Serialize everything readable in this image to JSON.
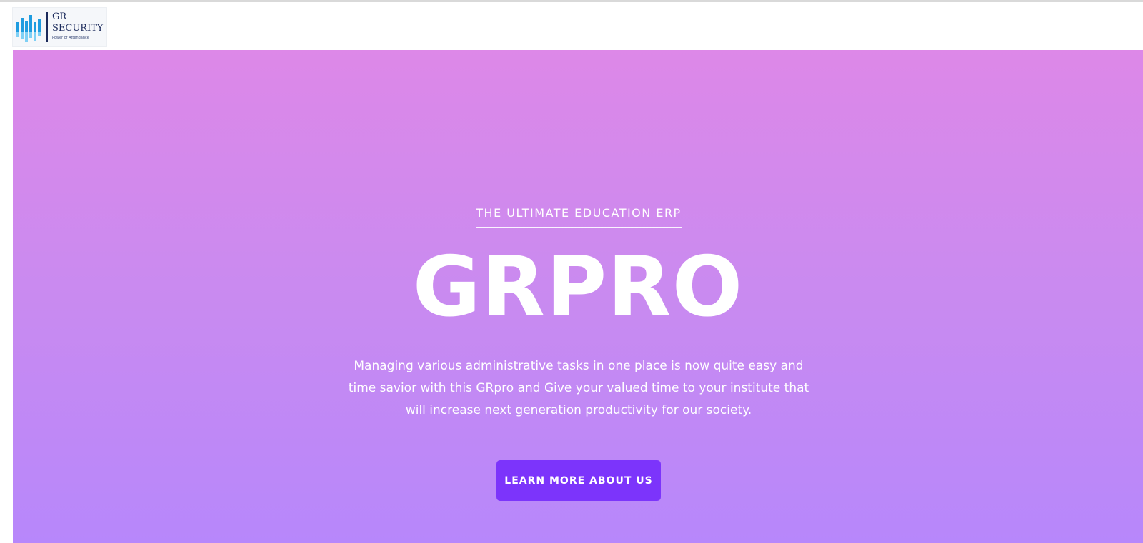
{
  "logo": {
    "line1": "GR",
    "line2": "SECURITY",
    "tagline": "Power of Attendance",
    "icon": "bar-chart-logo-icon",
    "colors": {
      "primary": "#1b2a5b",
      "bars_dark": "#1e9ce0",
      "bars_light": "#7fd0f5"
    }
  },
  "hero": {
    "eyebrow": "THE ULTIMATE EDUCATION ERP",
    "title": "GRPRO",
    "description": "Managing various administrative tasks in one place is now quite easy and time savior with this GRpro and Give your valued time to your institute that will increase next generation productivity for our society.",
    "cta_label": "LEARN MORE ABOUT US",
    "colors": {
      "gradient_top": "#dd88e8",
      "gradient_bottom": "#b787fb",
      "cta": "#7c34fb"
    }
  }
}
